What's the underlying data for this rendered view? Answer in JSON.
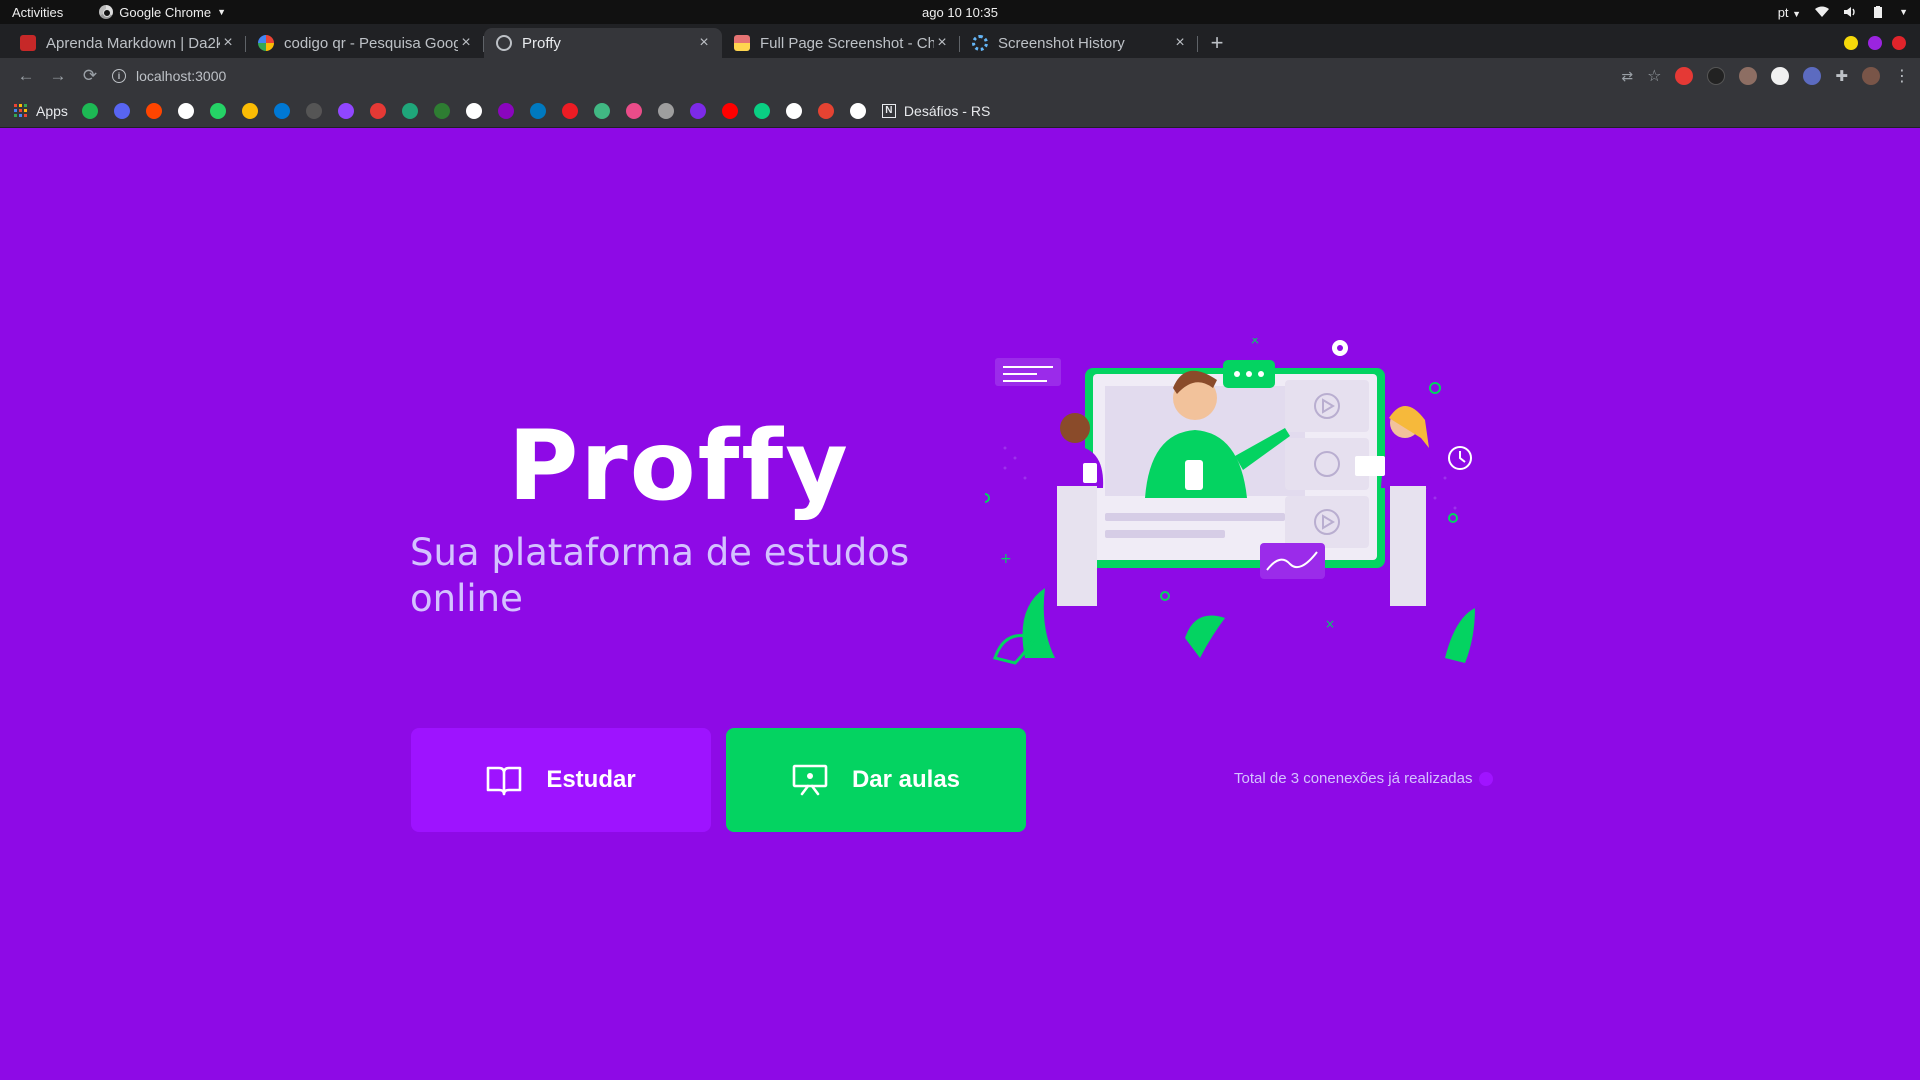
{
  "os_bar": {
    "activities": "Activities",
    "app_name": "Google Chrome",
    "clock": "ago 10  10:35",
    "language": "pt"
  },
  "tabs": [
    {
      "title": "Aprenda Markdown | Da2k",
      "favicon_color": "#c62828",
      "active": false
    },
    {
      "title": "codigo qr - Pesquisa Goog",
      "favicon_color": "#ffffff",
      "active": false
    },
    {
      "title": "Proffy",
      "favicon_color": "#bdc1c6",
      "active": true
    },
    {
      "title": "Full Page Screenshot - Chr",
      "favicon_color": "#e57373",
      "active": false
    },
    {
      "title": "Screenshot History",
      "favicon_color": "#64b5f6",
      "active": false
    }
  ],
  "address_bar": {
    "url": "localhost:3000"
  },
  "bookmarks": {
    "apps_label": "Apps",
    "folder_label": "Desáfios - RS",
    "icons": [
      "spotify-icon",
      "discord-icon",
      "reddit-icon",
      "rocket-icon",
      "whatsapp-icon",
      "drive-icon",
      "outlook-icon",
      "github-icon",
      "twitch-icon",
      "calendar-icon",
      "s-icon",
      "f-icon",
      "google-icon",
      "nubank-icon",
      "trello-icon",
      "trakt-icon",
      "vue-icon",
      "dribbble-icon",
      "gitmoji-icon",
      "canva-icon",
      "youtube-icon",
      "figma-icon",
      "vercel-icon",
      "todoist-icon",
      "notion-icon"
    ],
    "colors": [
      "#1db954",
      "#5865f2",
      "#ff4500",
      "#ffffff",
      "#25d366",
      "#fbbc04",
      "#0078d4",
      "#555555",
      "#9146ff",
      "#e53935",
      "#1fa67a",
      "#2e7d32",
      "#ffffff",
      "#8a05be",
      "#0079bf",
      "#ed1c24",
      "#41b883",
      "#ea4c89",
      "#9e9e9e",
      "#7d2ae8",
      "#ff0000",
      "#0acf83",
      "#ffffff",
      "#e44332",
      "#ffffff"
    ]
  },
  "page": {
    "logo": "Proffy",
    "tagline": "Sua plataforma de estudos online",
    "study_button": "Estudar",
    "teach_button": "Dar aulas",
    "total_connections": "Total de 3 conenexões já realizadas",
    "colors": {
      "background": "#8e0ae6",
      "study": "#9e13ff",
      "teach": "#04d361"
    }
  }
}
